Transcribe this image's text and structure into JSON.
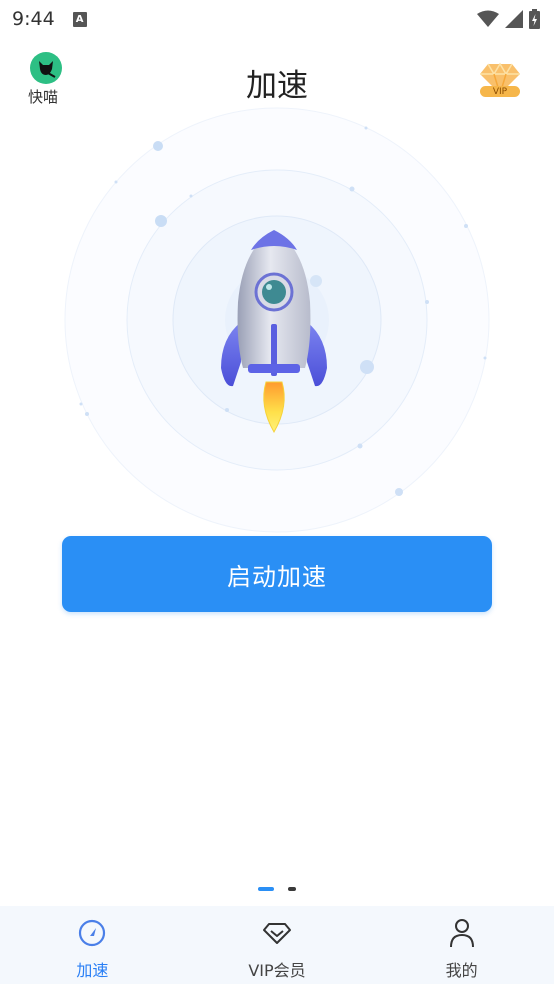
{
  "status_bar": {
    "time": "9:44",
    "notification_badge": "A"
  },
  "header": {
    "brand_name": "快喵",
    "title": "加速",
    "vip_label": "VIP"
  },
  "main": {
    "start_button_label": "启动加速",
    "pager": {
      "total": 2,
      "active_index": 0
    }
  },
  "tabbar": {
    "tabs": [
      {
        "label": "加速",
        "icon": "speedometer-icon",
        "active": true
      },
      {
        "label": "VIP会员",
        "icon": "diamond-icon",
        "active": false
      },
      {
        "label": "我的",
        "icon": "person-icon",
        "active": false
      }
    ]
  },
  "colors": {
    "accent": "#2a8ff5",
    "brand_green": "#2dbf84",
    "vip_gold": "#f4a93c",
    "tabbar_bg": "#f4f8fd"
  }
}
